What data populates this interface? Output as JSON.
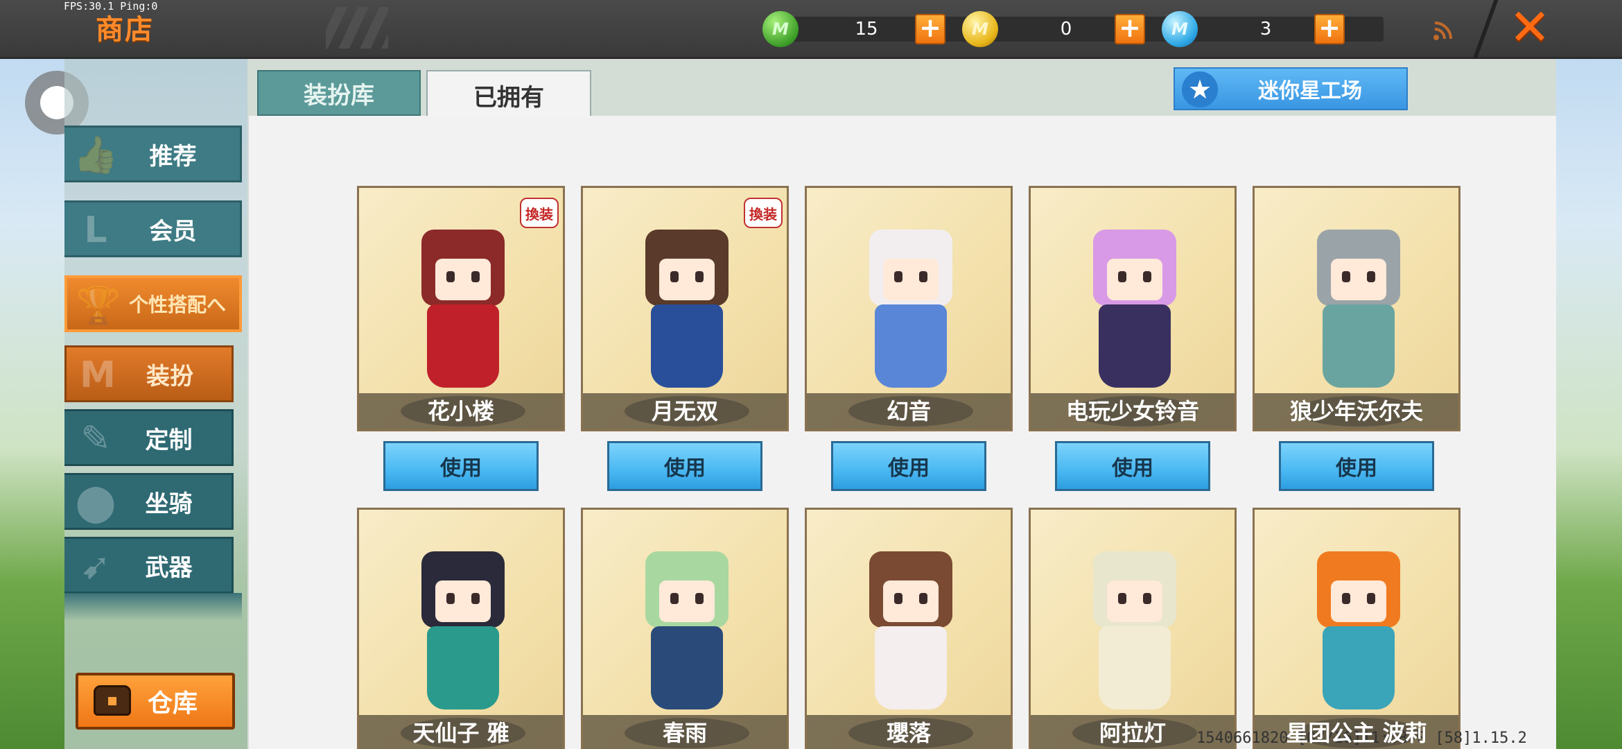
{
  "status": {
    "fps": "FPS:30.1 Ping:0"
  },
  "header": {
    "title": "商店",
    "currencies": [
      {
        "name": "mini-bean",
        "coin_text": "M",
        "value": "15"
      },
      {
        "name": "mini-coin",
        "coin_text": "M",
        "value": "0"
      },
      {
        "name": "mini-point",
        "coin_text": "M",
        "value": "3"
      }
    ],
    "plus": "+",
    "close": "✕"
  },
  "sidebar": {
    "items": [
      {
        "label": "推荐",
        "icon": "thumbs-up-icon",
        "glyph": "👍"
      },
      {
        "label": "会员",
        "icon": "member-icon",
        "glyph": "L"
      },
      {
        "label": "个性搭配へ",
        "icon": "trophy-icon",
        "glyph": "🏆"
      },
      {
        "label": "装扮",
        "icon": "shirt-icon",
        "glyph": "M"
      },
      {
        "label": "定制",
        "icon": "pencil-icon",
        "glyph": "✎"
      },
      {
        "label": "坐骑",
        "icon": "footprint-icon",
        "glyph": "⬤"
      },
      {
        "label": "武器",
        "icon": "gun-icon",
        "glyph": "➹"
      }
    ],
    "warehouse": "仓库"
  },
  "tabs": {
    "library": "装扮库",
    "owned": "已拥有"
  },
  "workshop": {
    "label": "迷你星工场",
    "star": "★"
  },
  "skins": [
    {
      "name": "花小楼",
      "badge": "換装",
      "hair": "#8c2a2a",
      "body": "#c0202a"
    },
    {
      "name": "月无双",
      "badge": "換装",
      "hair": "#5a3a2a",
      "body": "#2a4f9a"
    },
    {
      "name": "幻音",
      "badge": "",
      "hair": "#f2eef0",
      "body": "#5a86d8"
    },
    {
      "name": "电玩少女铃音",
      "badge": "",
      "hair": "#d89ae6",
      "body": "#3a3060"
    },
    {
      "name": "狼少年沃尔夫",
      "badge": "",
      "hair": "#9aa3a8",
      "body": "#6aa4a0"
    },
    {
      "name": "天仙子 雅",
      "badge": "",
      "hair": "#2a2a3a",
      "body": "#2a9a8c"
    },
    {
      "name": "春雨",
      "badge": "",
      "hair": "#a8d8a0",
      "body": "#2a4a7a"
    },
    {
      "name": "瓔落",
      "badge": "",
      "hair": "#7a4a32",
      "body": "#f4eeee"
    },
    {
      "name": "阿拉灯",
      "badge": "",
      "hair": "#e8e6cc",
      "body": "#f2ecd4"
    },
    {
      "name": "星团公主 波莉",
      "badge": "",
      "hair": "#f07a20",
      "body": "#3aa4b8"
    }
  ],
  "use_label": "使用",
  "footer": {
    "info": "1540661820  [07/16]11:58 0  [58]1.15.2"
  }
}
